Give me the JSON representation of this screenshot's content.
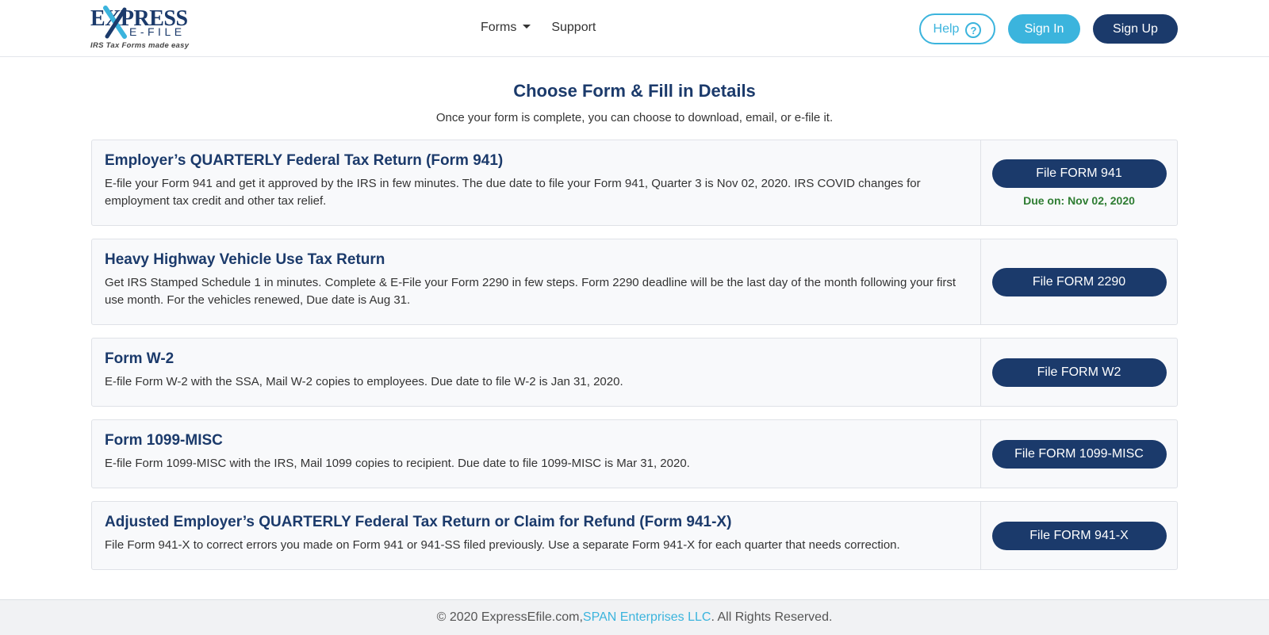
{
  "logo": {
    "express": "EXPRESS",
    "efile": "E-FILE",
    "tagline": "IRS Tax Forms made easy"
  },
  "nav": {
    "forms": "Forms",
    "support": "Support"
  },
  "header_buttons": {
    "help": "Help",
    "help_icon": "?",
    "sign_in": "Sign In",
    "sign_up": "Sign Up"
  },
  "main": {
    "title": "Choose Form & Fill in Details",
    "subtitle": "Once your form is complete, you can choose to download, email, or e-file it."
  },
  "forms": [
    {
      "title": "Employer’s QUARTERLY Federal Tax Return (Form 941)",
      "description": "E-file your Form 941 and get it approved by the IRS in few minutes. The due date to file your Form 941, Quarter 3 is Nov 02, 2020. IRS COVID changes for employment tax credit and other tax relief.",
      "button": "File FORM 941",
      "due": "Due on: Nov 02, 2020"
    },
    {
      "title": "Heavy Highway Vehicle Use Tax Return",
      "description": "Get IRS Stamped Schedule 1 in minutes. Complete & E-File your Form 2290 in few steps. Form 2290 deadline will be the last day of the month following your first use month. For the vehicles renewed, Due date is Aug 31.",
      "button": "File FORM 2290"
    },
    {
      "title": "Form W-2",
      "description": "E-file Form W-2 with the SSA, Mail W-2 copies to employees. Due date to file W-2 is Jan 31, 2020.",
      "button": "File FORM W2"
    },
    {
      "title": "Form 1099-MISC",
      "description": "E-file Form 1099-MISC with the IRS, Mail 1099 copies to recipient. Due date to file 1099-MISC is Mar 31, 2020.",
      "button": "File FORM 1099-MISC"
    },
    {
      "title": "Adjusted Employer’s QUARTERLY Federal Tax Return or Claim for Refund (Form 941-X)",
      "description": "File Form 941-X to correct errors you made on Form 941 or 941-SS filed previously. Use a separate Form 941-X for each quarter that needs correction.",
      "button": "File FORM 941-X"
    }
  ],
  "footer": {
    "prefix": "© 2020 ExpressEfile.com, ",
    "link": "SPAN Enterprises LLC",
    "suffix": ". All Rights Reserved."
  },
  "colors": {
    "navy": "#1b3a6b",
    "cyan": "#3bb4dd",
    "due_green": "#2e7d32"
  }
}
